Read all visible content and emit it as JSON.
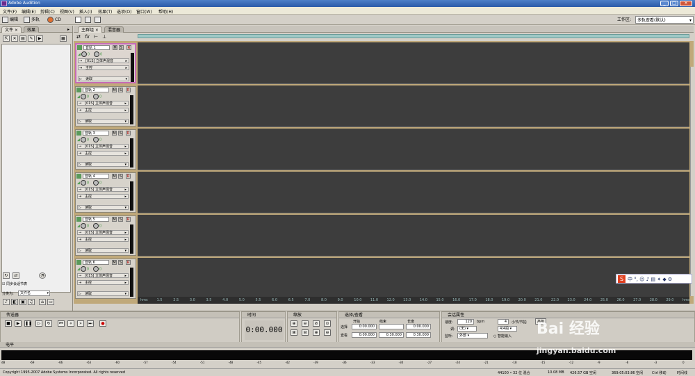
{
  "window": {
    "title": "Adobe Audition"
  },
  "menu": [
    "文件(F)",
    "编辑(E)",
    "剪辑(C)",
    "视图(V)",
    "插入(I)",
    "效果(T)",
    "选项(O)",
    "窗口(W)",
    "帮助(H)"
  ],
  "toolbar": {
    "edit_label": "编辑",
    "multitrack_label": "多轨",
    "cd_label": "CD",
    "workspace_label": "工作区:",
    "workspace_value": "多轨查看(默认)"
  },
  "file_panel": {
    "tab_files": "文件",
    "tab_effects": "效果",
    "checkbox_label": "同步会话节表",
    "sort_label": "分类为:",
    "sort_value": "文件名"
  },
  "main_panel": {
    "tab_main": "主群组",
    "tab_mixer": "混音器"
  },
  "tracks": [
    {
      "name": "音轨 1",
      "fx": "[01S] 立体声混音",
      "out": "主控",
      "mode": "读取",
      "vol": "0",
      "pan": "0"
    },
    {
      "name": "音轨 2",
      "fx": "[01S] 立体声混音",
      "out": "主控",
      "mode": "读取",
      "vol": "0",
      "pan": "0"
    },
    {
      "name": "音轨 3",
      "fx": "[01S] 立体声混音",
      "out": "主控",
      "mode": "读取",
      "vol": "0",
      "pan": "0"
    },
    {
      "name": "音轨 4",
      "fx": "[01S] 立体声混音",
      "out": "主控",
      "mode": "读取",
      "vol": "0",
      "pan": "0"
    },
    {
      "name": "音轨 5",
      "fx": "[01S] 立体声混音",
      "out": "主控",
      "mode": "读取",
      "vol": "0",
      "pan": "0"
    },
    {
      "name": "音轨 6",
      "fx": "[01S] 立体声混音",
      "out": "主控",
      "mode": "读取",
      "vol": "0",
      "pan": "0"
    }
  ],
  "track_buttons": {
    "m": "M",
    "s": "S",
    "r": "R"
  },
  "timeline_ticks": [
    "hms",
    "1.5",
    "2.5",
    "3.0",
    "3.5",
    "4.0",
    "5.0",
    "5.5",
    "6.0",
    "6.5",
    "7.0",
    "8.0",
    "9.0",
    "10.0",
    "11.0",
    "12.0",
    "13.0",
    "14.0",
    "15.0",
    "16.0",
    "17.0",
    "18.0",
    "19.0",
    "20.0",
    "21.0",
    "22.0",
    "23.0",
    "24.0",
    "25.0",
    "26.0",
    "27.0",
    "28.0",
    "29.0",
    "hms"
  ],
  "transport": {
    "title": "传送器"
  },
  "time_panel": {
    "title": "时间",
    "value": "0:00.000"
  },
  "zoom_panel": {
    "title": "缩放"
  },
  "selection": {
    "title": "选择/查看",
    "col_start": "开始",
    "col_end": "结束",
    "col_length": "长度",
    "row_select": "选择",
    "row_view": "查看",
    "sel_start": "0:00.000",
    "sel_end": "",
    "sel_len": "0:00.000",
    "view_start": "0:00.000",
    "view_end": "0:30.000",
    "view_len": "0:30.000"
  },
  "session": {
    "title": "会话属性",
    "tempo_label": "速度:",
    "tempo": "120",
    "bpm": "bpm",
    "beats": "4",
    "beats_label": "小节/节拍",
    "key_label": "调:",
    "key_value": "(无)",
    "time_sig": "4/4拍",
    "monitor_label": "监听:",
    "monitor_value": "外部",
    "smart_input": "智能输入",
    "advanced": "高级"
  },
  "level": {
    "title": "电平",
    "scale": [
      "dB",
      "-69",
      "-66",
      "-63",
      "-60",
      "-57",
      "-54",
      "-51",
      "-48",
      "-45",
      "-42",
      "-39",
      "-36",
      "-33",
      "-30",
      "-27",
      "-24",
      "-21",
      "-18",
      "-15",
      "-12",
      "-9",
      "-6",
      "-3",
      "0"
    ]
  },
  "status": {
    "copyright": "Copyright 1995-2007 Adobe Systems Incorporated. All rights reserved",
    "format": "44100 • 32 位 混合",
    "size": "10.08 MB",
    "free": "426.57 GB 空闲",
    "time_free": "369:05:03.86 空闲",
    "ctrl": "Ctrl 移动",
    "mode": "时间线"
  },
  "watermark": {
    "brand": "Bai 经验",
    "url": "jingyan.baidu.com"
  }
}
